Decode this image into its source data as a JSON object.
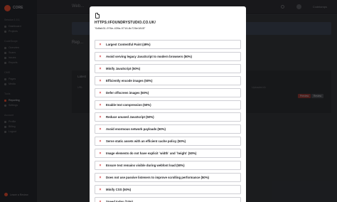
{
  "app": {
    "logo_text": "CORE",
    "topbar_title": "Web...",
    "user_name": "Codelamps"
  },
  "sidebar": {
    "sections": [
      {
        "label": "Session 1.0.1",
        "items": [
          "Dashboard",
          "Projects"
        ]
      },
      {
        "label": "CodeScope",
        "items": [
          "Overview",
          "Scans",
          "Issues",
          "Reports"
        ]
      },
      {
        "label": "CMS",
        "items": [
          "Pages",
          "Media"
        ]
      },
      {
        "label": "Tools",
        "items": [
          "Reporting",
          "Settings"
        ]
      },
      {
        "label": "Account",
        "items": [
          "Profile",
          "Billing",
          "Logout"
        ]
      }
    ],
    "active_item": "Reporting",
    "review_link": "Leave a Review"
  },
  "background": {
    "banner_text": "",
    "page_heading": "Rep...",
    "card_title": "Latest",
    "columns": [
      "URL",
      "Uploaded At"
    ],
    "buttons": [
      "Preview",
      "Review"
    ]
  },
  "modal": {
    "url": "HTTPS://FOUNDRYSTUDIO.CO.UK/",
    "id": "\"6dfab31-976e-439a-9716-8c726e1845\"",
    "audits": [
      {
        "label": "Largest Contentful Paint (49%)",
        "status": "fail"
      },
      {
        "label": "Avoid serving legacy JavaScript to modern browsers (50%)",
        "status": "fail"
      },
      {
        "label": "Minify JavaScript (50%)",
        "status": "fail"
      },
      {
        "label": "Efficiently encode images (50%)",
        "status": "fail"
      },
      {
        "label": "Defer offscreen images (50%)",
        "status": "fail"
      },
      {
        "label": "Enable text compression (50%)",
        "status": "fail"
      },
      {
        "label": "Reduce unused JavaScript (50%)",
        "status": "fail"
      },
      {
        "label": "Avoid enormous network payloads (50%)",
        "status": "fail"
      },
      {
        "label": "Serve static assets with an efficient cache policy (50%)",
        "status": "fail"
      },
      {
        "label": "Image elements do not have explicit `width` and `height` (50%)",
        "status": "fail"
      },
      {
        "label": "Ensure text remains visible during webfont load (50%)",
        "status": "fail"
      },
      {
        "label": "Does not use passive listeners to improve scrolling performance (50%)",
        "status": "fail"
      },
      {
        "label": "Minify CSS (50%)",
        "status": "fail"
      },
      {
        "label": "Speed Index (74%)",
        "status": "fail"
      }
    ]
  },
  "colors": {
    "accent": "#d94a2f",
    "fail_icon": "#d8393b"
  }
}
